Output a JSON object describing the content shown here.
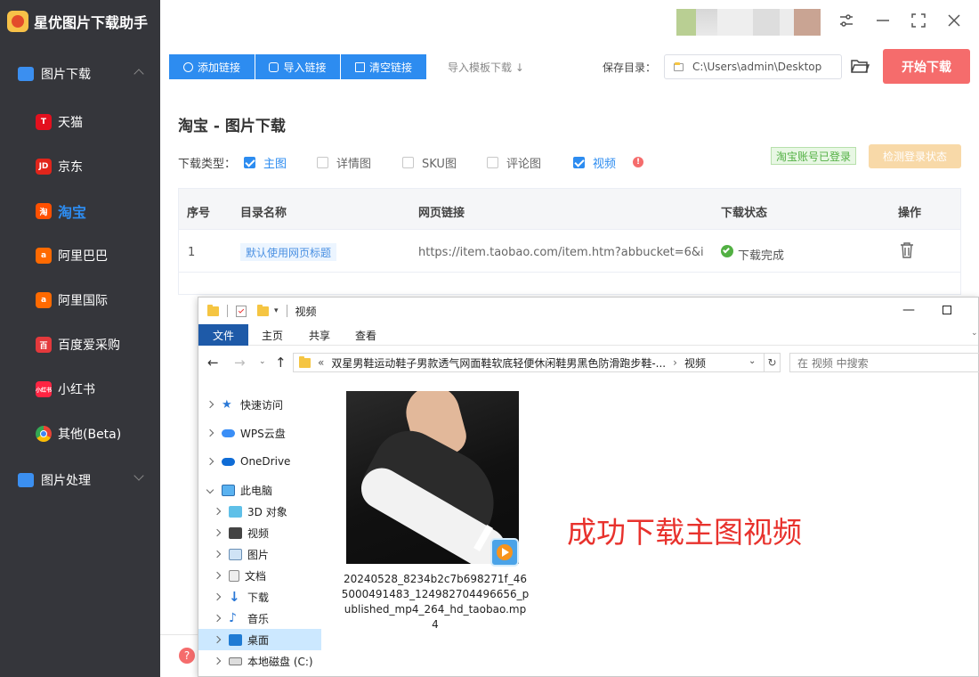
{
  "app": {
    "title": "星优图片下载助手"
  },
  "sidebar": {
    "group1": "图片下载",
    "group2": "图片处理",
    "sites": [
      {
        "label": "天猫",
        "icon": "T",
        "color": "#e3101e"
      },
      {
        "label": "京东",
        "icon": "JD",
        "color": "#e1251b"
      },
      {
        "label": "淘宝",
        "icon": "淘",
        "color": "#ff5000"
      },
      {
        "label": "阿里巴巴",
        "icon": "a",
        "color": "#ff6a00"
      },
      {
        "label": "阿里国际",
        "icon": "a",
        "color": "#ff6a00"
      },
      {
        "label": "百度爱采购",
        "icon": "百",
        "color": "#e4393c"
      },
      {
        "label": "小红书",
        "icon": "小红书",
        "color": "#ff2442"
      },
      {
        "label": "其他(Beta)",
        "icon": "chrome-icon",
        "color": "#4285f4"
      }
    ]
  },
  "toolbar": {
    "add_link": "添加链接",
    "import_link": "导入链接",
    "clear_link": "清空链接",
    "import_template": "导入模板下载",
    "save_dir_label": "保存目录：",
    "save_dir": "C:\\Users\\admin\\Desktop",
    "start_download": "开始下载"
  },
  "page": {
    "title": "淘宝 - 图片下载",
    "type_label": "下载类型：",
    "types": [
      {
        "label": "主图",
        "checked": true
      },
      {
        "label": "详情图",
        "checked": false
      },
      {
        "label": "SKU图",
        "checked": false
      },
      {
        "label": "评论图",
        "checked": false
      },
      {
        "label": "视频",
        "checked": true
      }
    ],
    "login_badge": "淘宝账号已登录",
    "check_login": "检测登录状态"
  },
  "table": {
    "headers": [
      "序号",
      "目录名称",
      "网页链接",
      "下载状态",
      "操作"
    ],
    "rows": [
      {
        "index": "1",
        "dir": "默认使用网页标题",
        "url": "https://item.taobao.com/item.htm?abbucket=6&i...",
        "status": "下载完成"
      }
    ]
  },
  "explorer": {
    "title": "视频",
    "tabs": [
      "文件",
      "主页",
      "共享",
      "查看"
    ],
    "path": "双星男鞋运动鞋子男款透气网面鞋软底轻便休闲鞋男黑色防滑跑步鞋-...",
    "path_current": "视频",
    "path_prefix": "«",
    "search_placeholder": "在 视频 中搜索",
    "nav": [
      {
        "label": "快速访问",
        "indent": 0
      },
      {
        "label": "WPS云盘",
        "indent": 0
      },
      {
        "label": "OneDrive",
        "indent": 0
      },
      {
        "label": "此电脑",
        "indent": 0
      },
      {
        "label": "3D 对象",
        "indent": 1
      },
      {
        "label": "视频",
        "indent": 1
      },
      {
        "label": "图片",
        "indent": 1
      },
      {
        "label": "文档",
        "indent": 1
      },
      {
        "label": "下载",
        "indent": 1
      },
      {
        "label": "音乐",
        "indent": 1
      },
      {
        "label": "桌面",
        "indent": 1
      },
      {
        "label": "本地磁盘 (C:)",
        "indent": 1
      }
    ],
    "file_name": "20240528_8234b2c7b698271f_465000491483_124982704496656_published_mp4_264_hd_taobao.mp4",
    "annotation": "成功下载主图视频"
  },
  "colors": {
    "primary": "#2d8cf0",
    "start": "#f56c6c",
    "sidebar": "#35363b",
    "annotation": "#e8322d"
  }
}
